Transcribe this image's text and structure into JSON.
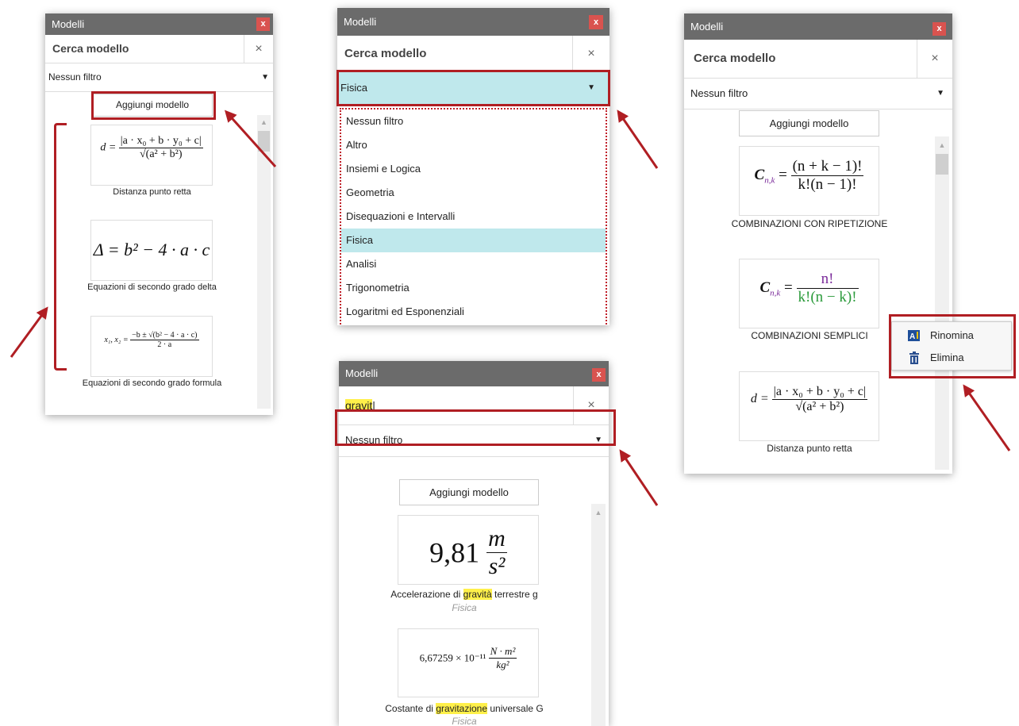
{
  "panels": {
    "p1": {
      "title": "Modelli",
      "close": "x",
      "search_placeholder": "Cerca modello",
      "search_clear": "×",
      "filter": "Nessun filtro",
      "add_button": "Aggiungi modello",
      "items": [
        {
          "caption": "Distanza punto retta"
        },
        {
          "caption": "Equazioni di secondo grado delta"
        },
        {
          "caption": "Equazioni di secondo grado formula"
        }
      ]
    },
    "p2": {
      "title": "Modelli",
      "close": "x",
      "search_placeholder": "Cerca modello",
      "search_clear": "×",
      "filter": "Fisica",
      "options": [
        "Nessun filtro",
        "Altro",
        "Insiemi e Logica",
        "Geometria",
        "Disequazioni e Intervalli",
        "Fisica",
        "Analisi",
        "Trigonometria",
        "Logaritmi ed Esponenziali"
      ],
      "selected_option": "Fisica"
    },
    "p3": {
      "title": "Modelli",
      "close": "x",
      "search_value": "gravit",
      "search_clear": "×",
      "filter": "Nessun filtro",
      "add_button": "Aggiungi modello",
      "items": [
        {
          "caption_pre": "Accelerazione di ",
          "caption_hl": "gravità",
          "caption_post": " terrestre g",
          "category": "Fisica"
        },
        {
          "caption_pre": "Costante di ",
          "caption_hl": "gravitazione",
          "caption_post": " universale G",
          "category": "Fisica"
        }
      ]
    },
    "p4": {
      "title": "Modelli",
      "close": "x",
      "search_placeholder": "Cerca modello",
      "search_clear": "×",
      "filter": "Nessun filtro",
      "add_button": "Aggiungi modello",
      "items": [
        {
          "caption": "COMBINAZIONI CON RIPETIZIONE"
        },
        {
          "caption": "COMBINAZIONI SEMPLICI"
        },
        {
          "caption": "Distanza punto retta"
        }
      ],
      "context_menu": [
        "Rinomina",
        "Elimina"
      ]
    }
  },
  "formulas": {
    "distance_lhs": "d =",
    "distance_num": "|a · x₀ + b · y₀ + c|",
    "distance_den": "√(a² + b²)",
    "delta": "Δ = b² − 4 · a · c",
    "quadratic_lhs": "x₁, x₂ =",
    "quadratic_num": "−b ± √(b² − 4 · a · c)",
    "quadratic_den": "2 · a",
    "g_value": "9,81",
    "g_unit_num": "m",
    "g_unit_den": "s²",
    "G_value": "6,67259 × 10⁻¹¹",
    "G_unit_num": "N · m²",
    "G_unit_den": "kg²",
    "comb_rep_lhs": "C",
    "comb_rep_sub": "n,k",
    "comb_rep_num": "(n + k − 1)!",
    "comb_rep_den": "k!(n − 1)!",
    "comb_simple_lhs": "C",
    "comb_simple_sub": "n,k",
    "comb_simple_num": "n!",
    "comb_simple_den": "k!(n − k)!"
  },
  "colors": {
    "annotation": "#b01e23",
    "highlight": "#fff04a",
    "selected": "#bfe8ec",
    "titlebar": "#6b6b6b",
    "close": "#d9534f"
  }
}
